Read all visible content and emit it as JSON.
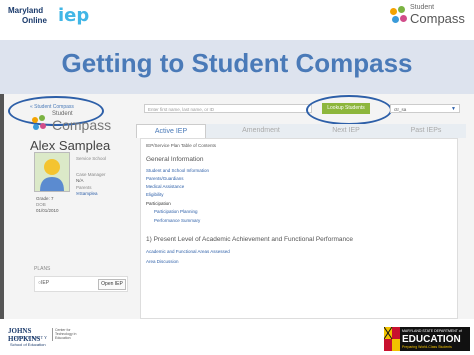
{
  "header": {
    "mo_logo_line1": "Maryland",
    "mo_logo_line2": "Online",
    "mo_logo_mark": "iep",
    "sc_logo_small": "Student",
    "sc_logo_big": "Compass"
  },
  "slide_title": "Getting to Student Compass",
  "app": {
    "back_link": "« Student Compass",
    "logo_small": "Student",
    "logo_big": "Compass",
    "search_placeholder": "Enter first name, last name, or ID",
    "lookup_label": "Lookup Students",
    "user_select": "ctr_sa",
    "tabs": [
      {
        "label": "Active IEP",
        "active": true
      },
      {
        "label": "Amendment",
        "active": false
      },
      {
        "label": "Next IEP",
        "active": false
      },
      {
        "label": "Past IEPs",
        "active": false
      }
    ],
    "student_name": "Alex Samplea",
    "profile": {
      "service_school_label": "Service School",
      "case_manager_label": "Case Manager",
      "case_manager_value": "N/A",
      "parents_label": "Parents",
      "parents_value": "Samplea",
      "grade": "Grade: 7",
      "dob_label": "DOB",
      "dob_value": "01/01/2010"
    },
    "plans_header": "PLANS",
    "plan_item": "IEP",
    "open_iep_label": "Open IEP",
    "content": {
      "breadcrumb": "IEP/Service Plan Table of Contents",
      "section1": "General Information",
      "links1": [
        "Student and School Information",
        "Parents/Guardians",
        "Medical Assistance",
        "Eligibility"
      ],
      "participation": "Participation",
      "links2": [
        "Participation Planning",
        "Performance Summary"
      ],
      "section2": "1) Present Level of Academic Achievement and Functional Performance",
      "links3": [
        "Academic and Functional Areas Assessed",
        "Area Discussion"
      ]
    }
  },
  "footer": {
    "jh_line1": "JOHNS HOPKINS",
    "jh_line2": "UNIVERSITY",
    "jh_school": "School of Education",
    "center": "Center for Technology in Education",
    "msde_line1": "MARYLAND STATE DEPARTMENT of",
    "msde_line2": "EDUCATION",
    "msde_line3": "Preparing World-Class Students"
  },
  "colors": {
    "title": "#4a7ab8",
    "accent_oval": "#2d5fa8",
    "lookup_button": "#8db63c"
  }
}
